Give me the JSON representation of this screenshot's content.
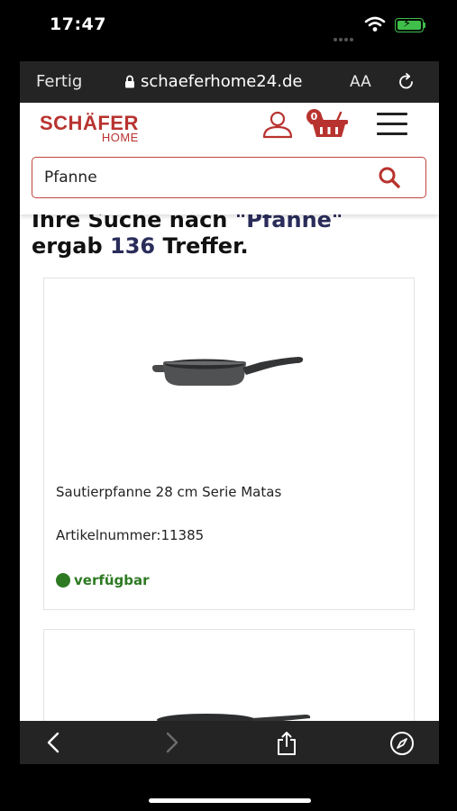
{
  "status_bar": {
    "time": "17:47"
  },
  "browser": {
    "done_label": "Fertig",
    "url": "schaeferhome24.de",
    "text_size_label": "AA"
  },
  "site": {
    "logo_main": "SCHÄFER",
    "logo_sub": "HOME",
    "cart_count": "0",
    "search": {
      "value": "Pfanne"
    }
  },
  "results": {
    "line1_prefix": "Ihre Suche nach ",
    "query_quoted": "\"Pfanne\"",
    "line2_prefix": "ergab ",
    "count": "136",
    "line2_suffix": " Treffer."
  },
  "products": [
    {
      "name": "Sautierpfanne 28 cm Serie Matas",
      "sku": "Artikelnummer:11385",
      "availability": "verfügbar"
    }
  ],
  "colors": {
    "brand": "#b8332f",
    "available": "#2d7a22",
    "highlight": "#2a2d5a"
  }
}
